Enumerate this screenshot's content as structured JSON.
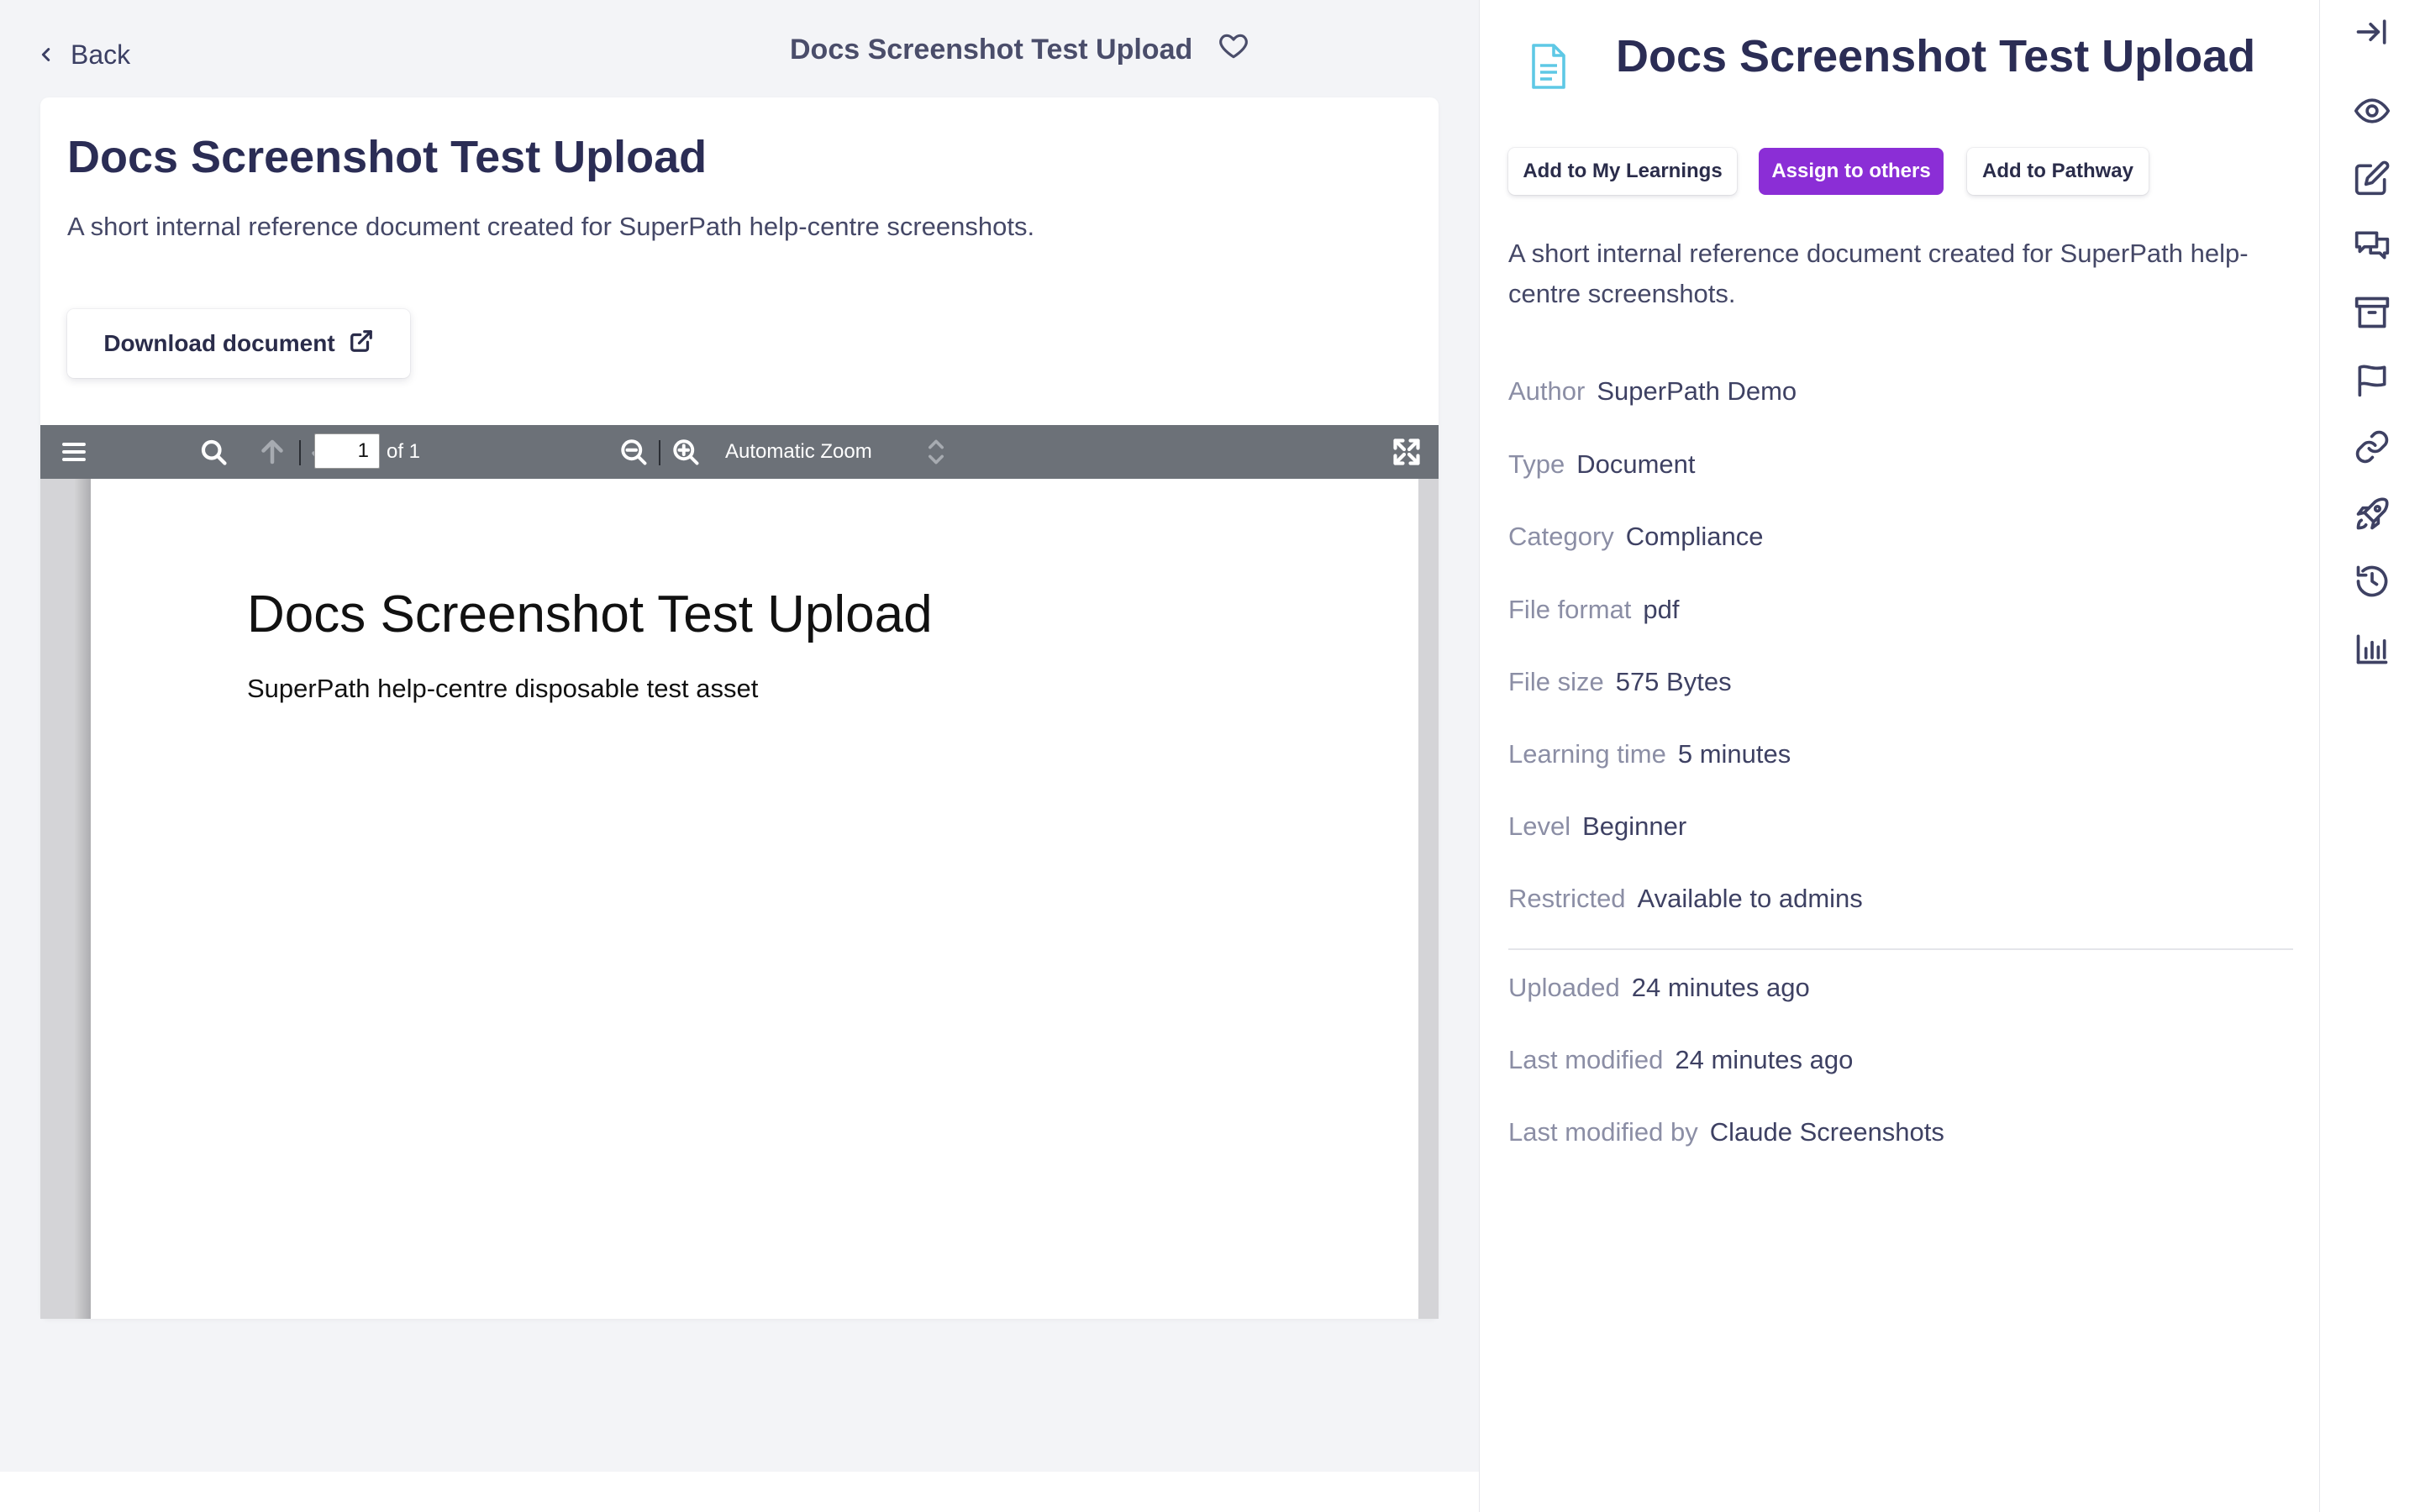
{
  "header": {
    "back_label": "Back",
    "title": "Docs Screenshot Test Upload"
  },
  "document": {
    "title": "Docs Screenshot Test Upload",
    "description": "A short internal reference document created for SuperPath help-centre screenshots.",
    "download_label": "Download document"
  },
  "pdf_viewer": {
    "page_number": "1",
    "page_of": "of 1",
    "zoom": "Automatic Zoom",
    "content_heading": "Docs Screenshot Test Upload",
    "content_subtitle": "SuperPath help-centre disposable test asset"
  },
  "details": {
    "title": "Docs Screenshot Test Upload",
    "actions": {
      "add_to_my_learnings": "Add to My Learnings",
      "assign_to_others": "Assign to others",
      "add_to_pathway": "Add to Pathway"
    },
    "description": "A short internal reference document created for SuperPath help-centre screenshots.",
    "meta": [
      {
        "label": "Author",
        "value": "SuperPath Demo"
      },
      {
        "label": "Type",
        "value": "Document"
      },
      {
        "label": "Category",
        "value": "Compliance"
      },
      {
        "label": "File format",
        "value": "pdf"
      },
      {
        "label": "File size",
        "value": "575 Bytes"
      },
      {
        "label": "Learning time",
        "value": "5 minutes"
      },
      {
        "label": "Level",
        "value": "Beginner"
      },
      {
        "label": "Restricted",
        "value": "Available to admins"
      }
    ],
    "history": [
      {
        "label": "Uploaded",
        "value": "24 minutes ago"
      },
      {
        "label": "Last modified",
        "value": "24 minutes ago"
      },
      {
        "label": "Last modified by",
        "value": "Claude Screenshots"
      }
    ]
  },
  "colors": {
    "primary": "#8b2ed6",
    "title_text": "#2b2d55",
    "muted_label": "#8b8ea5",
    "file_icon": "#5ec8e5",
    "toolbar_bg": "#6c7178"
  },
  "icons": {
    "rail": [
      "collapse-panel-icon",
      "eye-icon",
      "edit-icon",
      "comments-icon",
      "archive-icon",
      "flag-icon",
      "link-icon",
      "rocket-icon",
      "history-icon",
      "analytics-icon"
    ]
  }
}
